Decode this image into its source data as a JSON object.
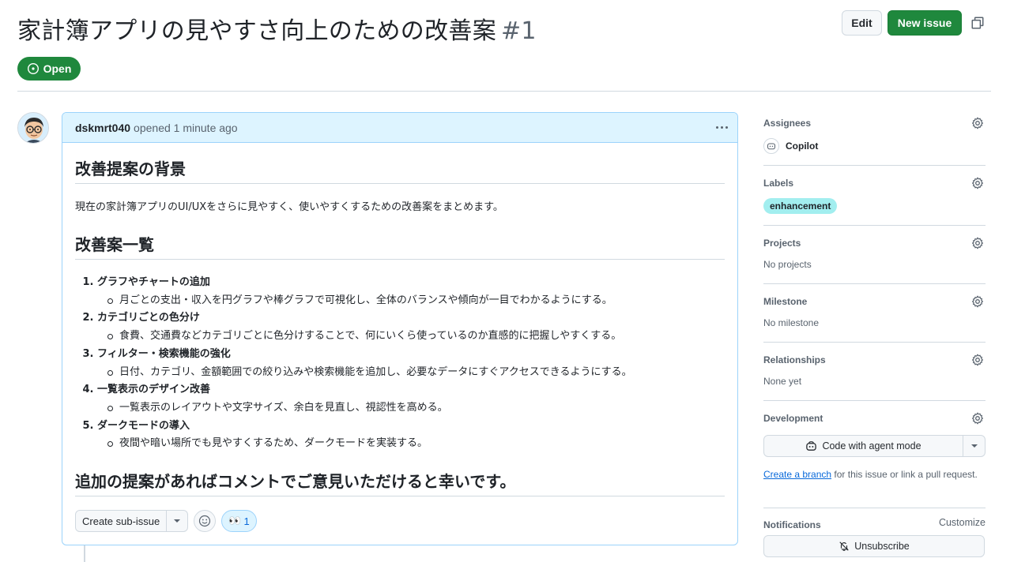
{
  "issue": {
    "title": "家計簿アプリの見やすさ向上のための改善案",
    "number": "#1",
    "state": "Open"
  },
  "header": {
    "edit_label": "Edit",
    "new_issue_label": "New issue"
  },
  "comment": {
    "author": "dskmrt040",
    "meta": "opened 1 minute ago",
    "h_background": "改善提案の背景",
    "p_background": "現在の家計簿アプリのUI/UXをさらに見やすく、使いやすくするための改善案をまとめます。",
    "h_list": "改善案一覧",
    "items": [
      {
        "title": "グラフやチャートの追加",
        "detail": "月ごとの支出・収入を円グラフや棒グラフで可視化し、全体のバランスや傾向が一目でわかるようにする。"
      },
      {
        "title": "カテゴリごとの色分け",
        "detail": "食費、交通費などカテゴリごとに色分けすることで、何にいくら使っているのか直感的に把握しやすくする。"
      },
      {
        "title": "フィルター・検索機能の強化",
        "detail": "日付、カテゴリ、金額範囲での絞り込みや検索機能を追加し、必要なデータにすぐアクセスできるようにする。"
      },
      {
        "title": "一覧表示のデザイン改善",
        "detail": "一覧表示のレイアウトや文字サイズ、余白を見直し、視認性を高める。"
      },
      {
        "title": "ダークモードの導入",
        "detail": "夜間や暗い場所でも見やすくするため、ダークモードを実装する。"
      }
    ],
    "h_closing": "追加の提案があればコメントでご意見いただけると幸いです。",
    "sub_issue_label": "Create sub-issue",
    "reaction_emoji": "👀",
    "reaction_count": "1"
  },
  "sidebar": {
    "assignees_title": "Assignees",
    "assignee_name": "Copilot",
    "labels_title": "Labels",
    "label_name": "enhancement",
    "projects_title": "Projects",
    "projects_value": "No projects",
    "milestone_title": "Milestone",
    "milestone_value": "No milestone",
    "relationships_title": "Relationships",
    "relationships_value": "None yet",
    "development_title": "Development",
    "agent_button": "Code with agent mode",
    "create_branch_link": "Create a branch",
    "dev_note_rest": " for this issue or link a pull request.",
    "notifications_title": "Notifications",
    "customize_label": "Customize",
    "unsubscribe_label": "Unsubscribe"
  }
}
